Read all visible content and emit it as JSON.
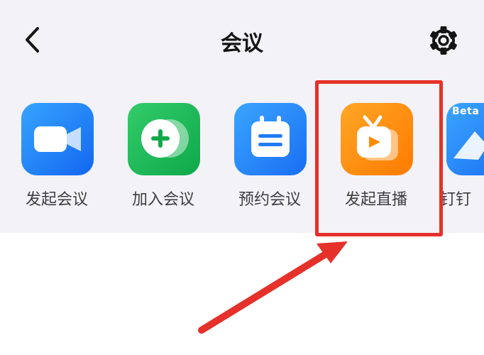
{
  "header": {
    "title": "会议",
    "back_icon": "chevron-left-icon",
    "settings_icon": "gear-icon"
  },
  "apps": [
    {
      "label": "发起会议",
      "icon": "video-camera-icon",
      "color": "#1f7cf5"
    },
    {
      "label": "加入会议",
      "icon": "plus-circle-icon",
      "color": "#1db954"
    },
    {
      "label": "预约会议",
      "icon": "calendar-icon",
      "color": "#1f7cf5"
    },
    {
      "label": "发起直播",
      "icon": "tv-play-icon",
      "color": "#ff8a00"
    },
    {
      "label": "钉钉",
      "icon": "dingtalk-icon",
      "badge": "Beta",
      "color": "#1f7cf5"
    }
  ],
  "annotation": {
    "highlight_color": "#e5312a"
  }
}
